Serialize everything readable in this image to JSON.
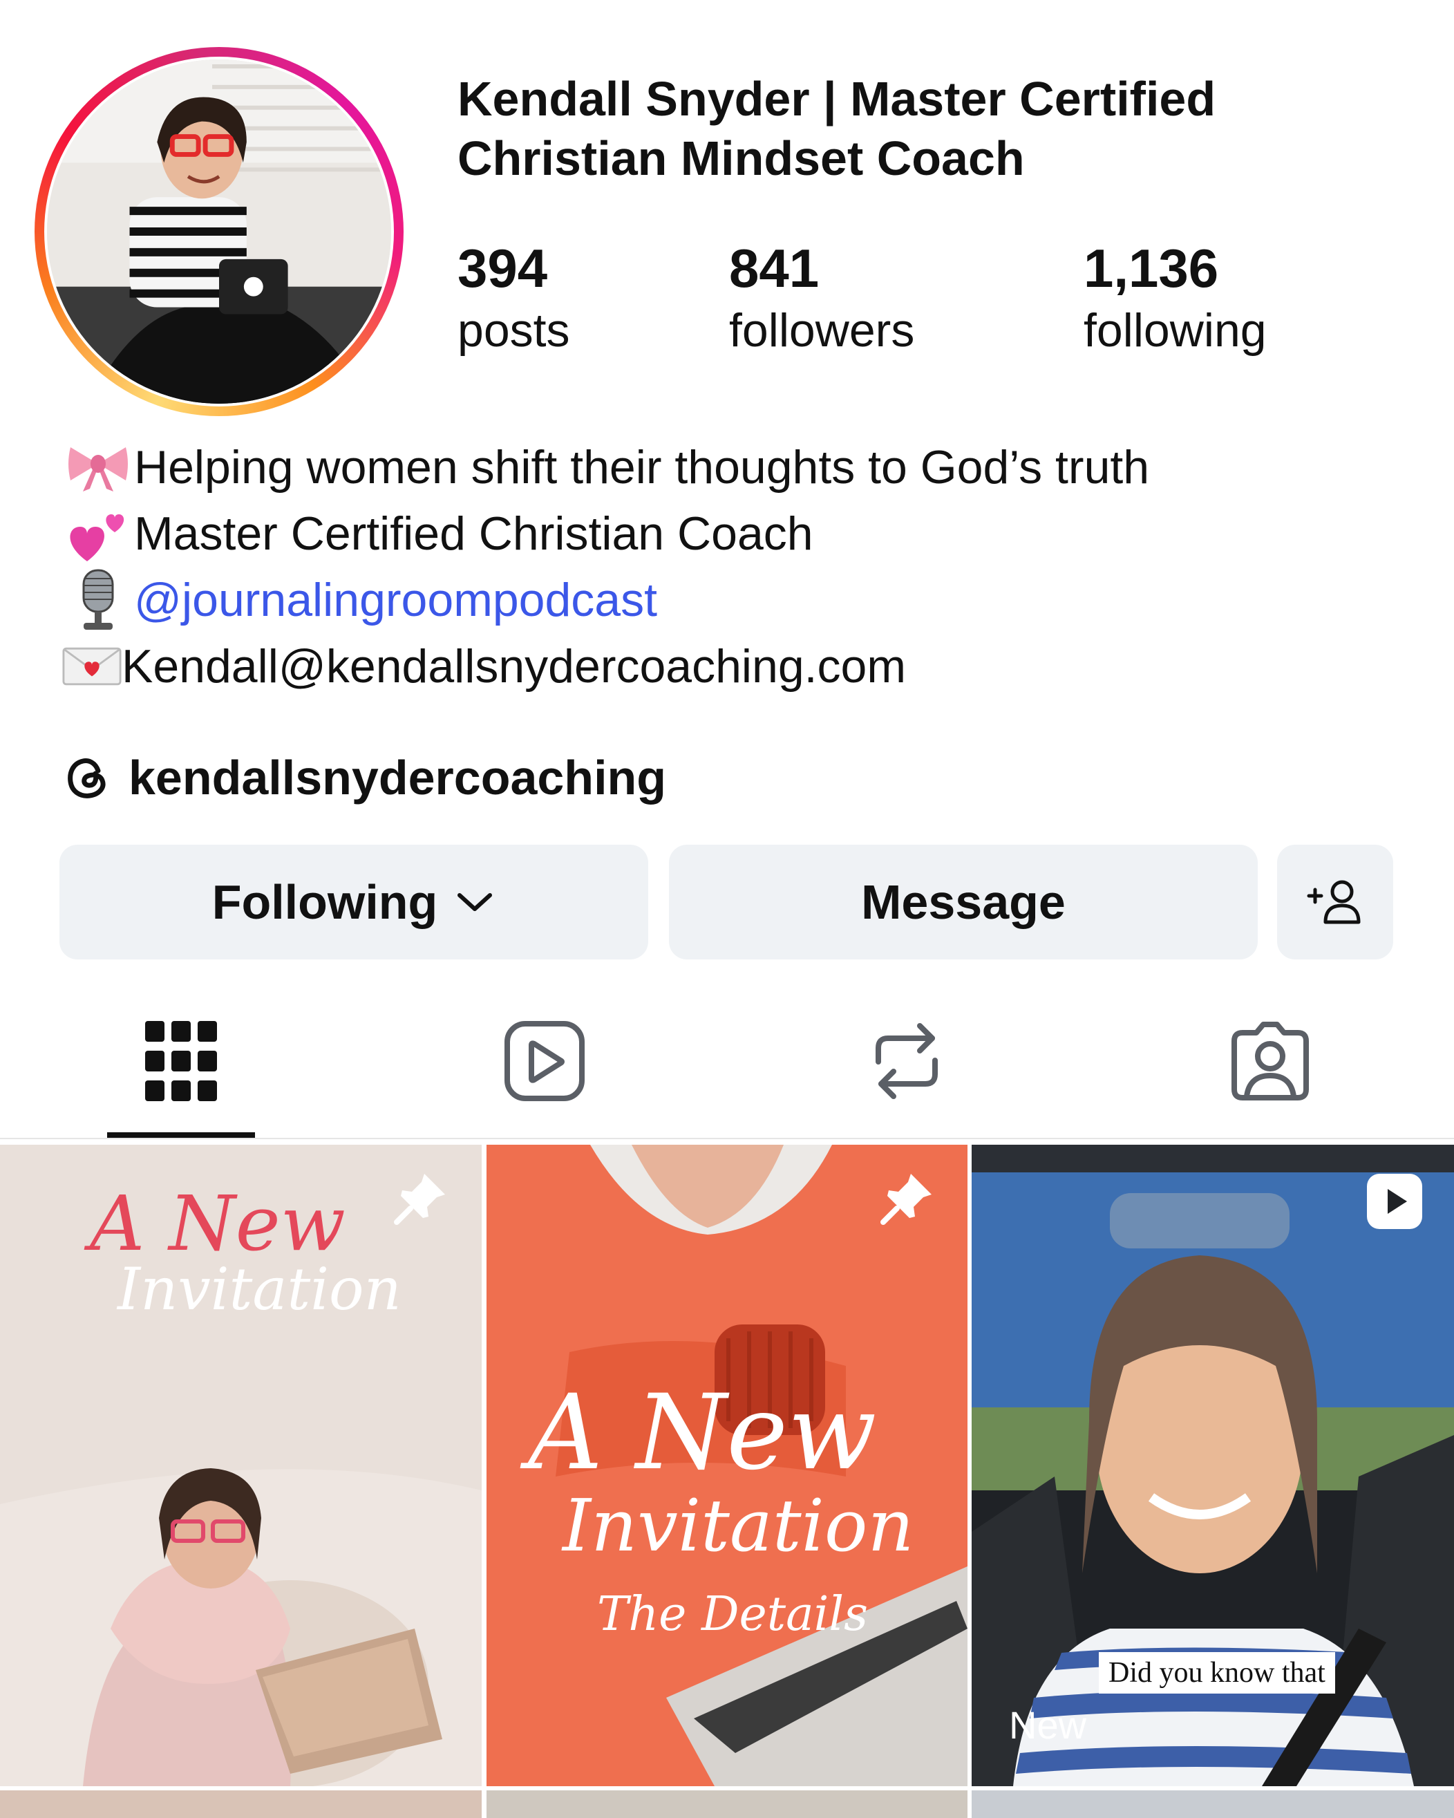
{
  "profile": {
    "display_name": "Kendall Snyder | Master Certified Christian Mindset Coach",
    "stats": [
      {
        "value": "394",
        "label": "posts"
      },
      {
        "value": "841",
        "label": "followers"
      },
      {
        "value": "1,136",
        "label": "following"
      }
    ],
    "bio": [
      {
        "icon": "ribbon-emoji",
        "text": "Helping women shift their thoughts to God’s truth"
      },
      {
        "icon": "two-hearts-emoji",
        "text": "Master Certified Christian Coach"
      },
      {
        "icon": "microphone-emoji",
        "text": "@journalingroompodcast"
      },
      {
        "icon": "love-letter-emoji",
        "text": "Kendall@kendallsnydercoaching.com"
      }
    ],
    "threads_handle": "kendallsnydercoaching"
  },
  "actions": {
    "following_label": "Following",
    "message_label": "Message",
    "add_person_icon": "add-person-icon"
  },
  "tabs": [
    {
      "name": "posts-grid",
      "icon": "grid-icon",
      "active": true
    },
    {
      "name": "reels",
      "icon": "reels-icon",
      "active": false
    },
    {
      "name": "reposts",
      "icon": "repost-icon",
      "active": false
    },
    {
      "name": "tagged",
      "icon": "tagged-icon",
      "active": false
    }
  ],
  "grid": [
    {
      "title_line1": "A New",
      "title_line2": "Invitation",
      "badge": "pin-icon"
    },
    {
      "title_line1": "A New",
      "title_line2": "Invitation",
      "title_line3": "The Details",
      "badge": "pin-icon"
    },
    {
      "caption": "Did you know that",
      "overlay": "New",
      "badge": "reel-icon"
    }
  ],
  "colors": {
    "link": "#3b57e8",
    "button_bg": "#eff2f5",
    "story_ring": [
      "#feda75",
      "#fa7e1e",
      "#d62976",
      "#e4169c"
    ]
  }
}
